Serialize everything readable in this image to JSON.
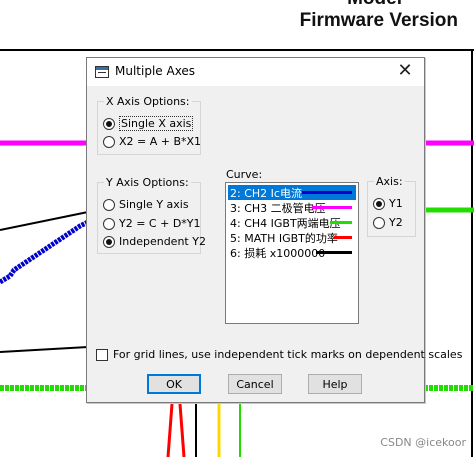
{
  "background": {
    "title_line1": "Model",
    "title_line2": "Firmware Version",
    "watermark": "CSDN @icekoor"
  },
  "dialog": {
    "title": "Multiple Axes",
    "close_glyph": "✕",
    "x_axis_options": {
      "legend": "X Axis Options:",
      "options": [
        {
          "label": "Single X axis",
          "selected": true
        },
        {
          "label": "X2 = A + B*X1",
          "selected": false
        }
      ]
    },
    "y_axis_options": {
      "legend": "Y Axis Options:",
      "options": [
        {
          "label": "Single Y axis",
          "selected": false
        },
        {
          "label": "Y2 = C + D*Y1",
          "selected": false
        },
        {
          "label": "Independent Y2",
          "selected": true
        }
      ]
    },
    "curve": {
      "label": "Curve:",
      "items": [
        {
          "label": "2: CH2 Ic电流",
          "color": "#0000cc",
          "selected": true
        },
        {
          "label": "3: CH3 二极管电压",
          "color": "#ff00ff",
          "selected": false
        },
        {
          "label": "4: CH4 IGBT两端电压",
          "color": "#22dd00",
          "selected": false
        },
        {
          "label": "5: MATH IGBT的功率",
          "color": "#ff0000",
          "selected": false
        },
        {
          "label": "6: 损耗 x1000000",
          "color": "#000000",
          "selected": false
        }
      ]
    },
    "axis": {
      "legend": "Axis:",
      "options": [
        {
          "label": "Y1",
          "selected": true
        },
        {
          "label": "Y2",
          "selected": false
        }
      ]
    },
    "grid_checkbox": {
      "label": "For grid lines, use independent tick marks on dependent scales",
      "checked": false
    },
    "buttons": {
      "ok": "OK",
      "cancel": "Cancel",
      "help": "Help"
    }
  }
}
